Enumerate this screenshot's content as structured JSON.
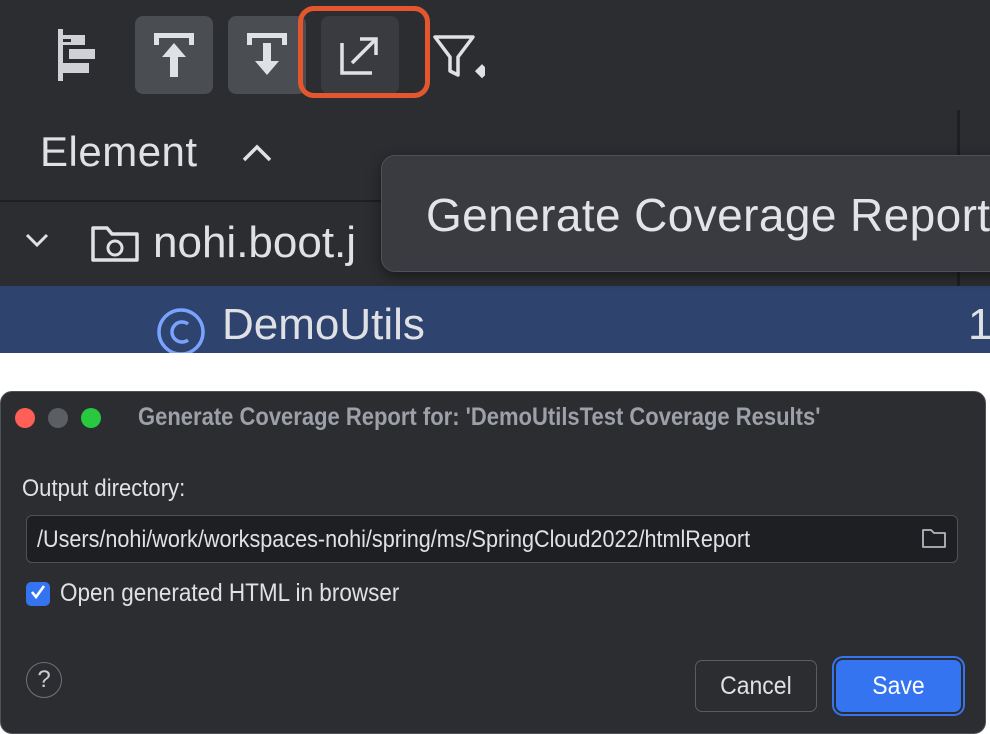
{
  "toolbar": {
    "icons": [
      "flatten-packages-icon",
      "import-icon",
      "export-icon",
      "generate-report-icon",
      "filter-icon"
    ]
  },
  "table": {
    "column_element": "Element",
    "package_label": "nohi.boot.j",
    "class_label": "DemoUtils",
    "class_value": "1"
  },
  "tooltip": {
    "text": "Generate Coverage Report"
  },
  "dialog": {
    "title": "Generate Coverage Report for: 'DemoUtilsTest Coverage Results'",
    "output_label": "Output directory:",
    "output_path": "/Users/nohi/work/workspaces-nohi/spring/ms/SpringCloud2022/htmlReport",
    "checkbox_label": "Open generated HTML in browser",
    "checkbox_checked": true,
    "help_label": "?",
    "cancel_label": "Cancel",
    "save_label": "Save"
  },
  "colors": {
    "highlight": "#e4572e",
    "accent": "#3574f0",
    "selection": "#2e436e",
    "background": "#2b2d30"
  }
}
